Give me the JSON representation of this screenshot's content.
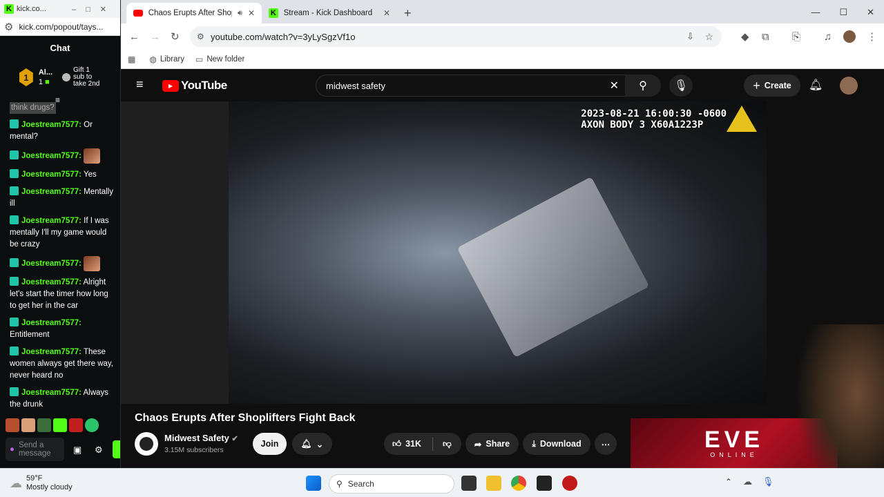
{
  "kick_window": {
    "title": "kick.co...",
    "url": "kick.com/popout/tays...",
    "chat_header": "Chat",
    "gifter_name": "Al...",
    "gifter_count": "1",
    "gift_promo": "Gift 1 sub to take 2nd",
    "messages": [
      {
        "user": "",
        "text": "think drugs?"
      },
      {
        "user": "Joestream7577:",
        "text": "Or mental?"
      },
      {
        "user": "Joestream7577:",
        "text": "",
        "emote": true
      },
      {
        "user": "Joestream7577:",
        "text": "Yes"
      },
      {
        "user": "Joestream7577:",
        "text": "Mentally ill"
      },
      {
        "user": "Joestream7577:",
        "text": "If I was mentally I'll my game would be crazy"
      },
      {
        "user": "Joestream7577:",
        "text": "",
        "emote": true
      },
      {
        "user": "Joestream7577:",
        "text": "Alright let's start the timer how long to get her in the car"
      },
      {
        "user": "Joestream7577:",
        "text": "Entitlement"
      },
      {
        "user": "Joestream7577:",
        "text": "These women always get there way, never heard no"
      },
      {
        "user": "Joestream7577:",
        "text": "Always the drunk"
      }
    ],
    "input_placeholder": "Send a message"
  },
  "browser": {
    "tabs": [
      {
        "label": "Chaos Erupts After Shoplifte",
        "active": true
      },
      {
        "label": "Stream - Kick Dashboard",
        "active": false
      }
    ],
    "url": "youtube.com/watch?v=3yLySgzVf1o",
    "bookmarks": [
      "Library",
      "New folder"
    ]
  },
  "youtube": {
    "logo_text": "YouTube",
    "search_value": "midwest safety",
    "create_label": "Create",
    "video_timestamp_line1": "2023-08-21 16:00:30 -0600",
    "video_timestamp_line2": "AXON BODY 3 X60A1223P",
    "video_title": "Chaos Erupts After Shoplifters Fight Back",
    "channel_name": "Midwest Safety",
    "subscribers": "3.15M subscribers",
    "join_label": "Join",
    "like_count": "31K",
    "share_label": "Share",
    "download_label": "Download",
    "ad_brand": "EVE",
    "ad_sub": "ONLINE"
  },
  "taskbar": {
    "weather_temp": "59°F",
    "weather_desc": "Mostly cloudy",
    "search_placeholder": "Search"
  },
  "colors": {
    "kick_green": "#53fc18",
    "youtube_red": "#ff0000",
    "chrome_tab_bg": "#dfe3e8"
  }
}
